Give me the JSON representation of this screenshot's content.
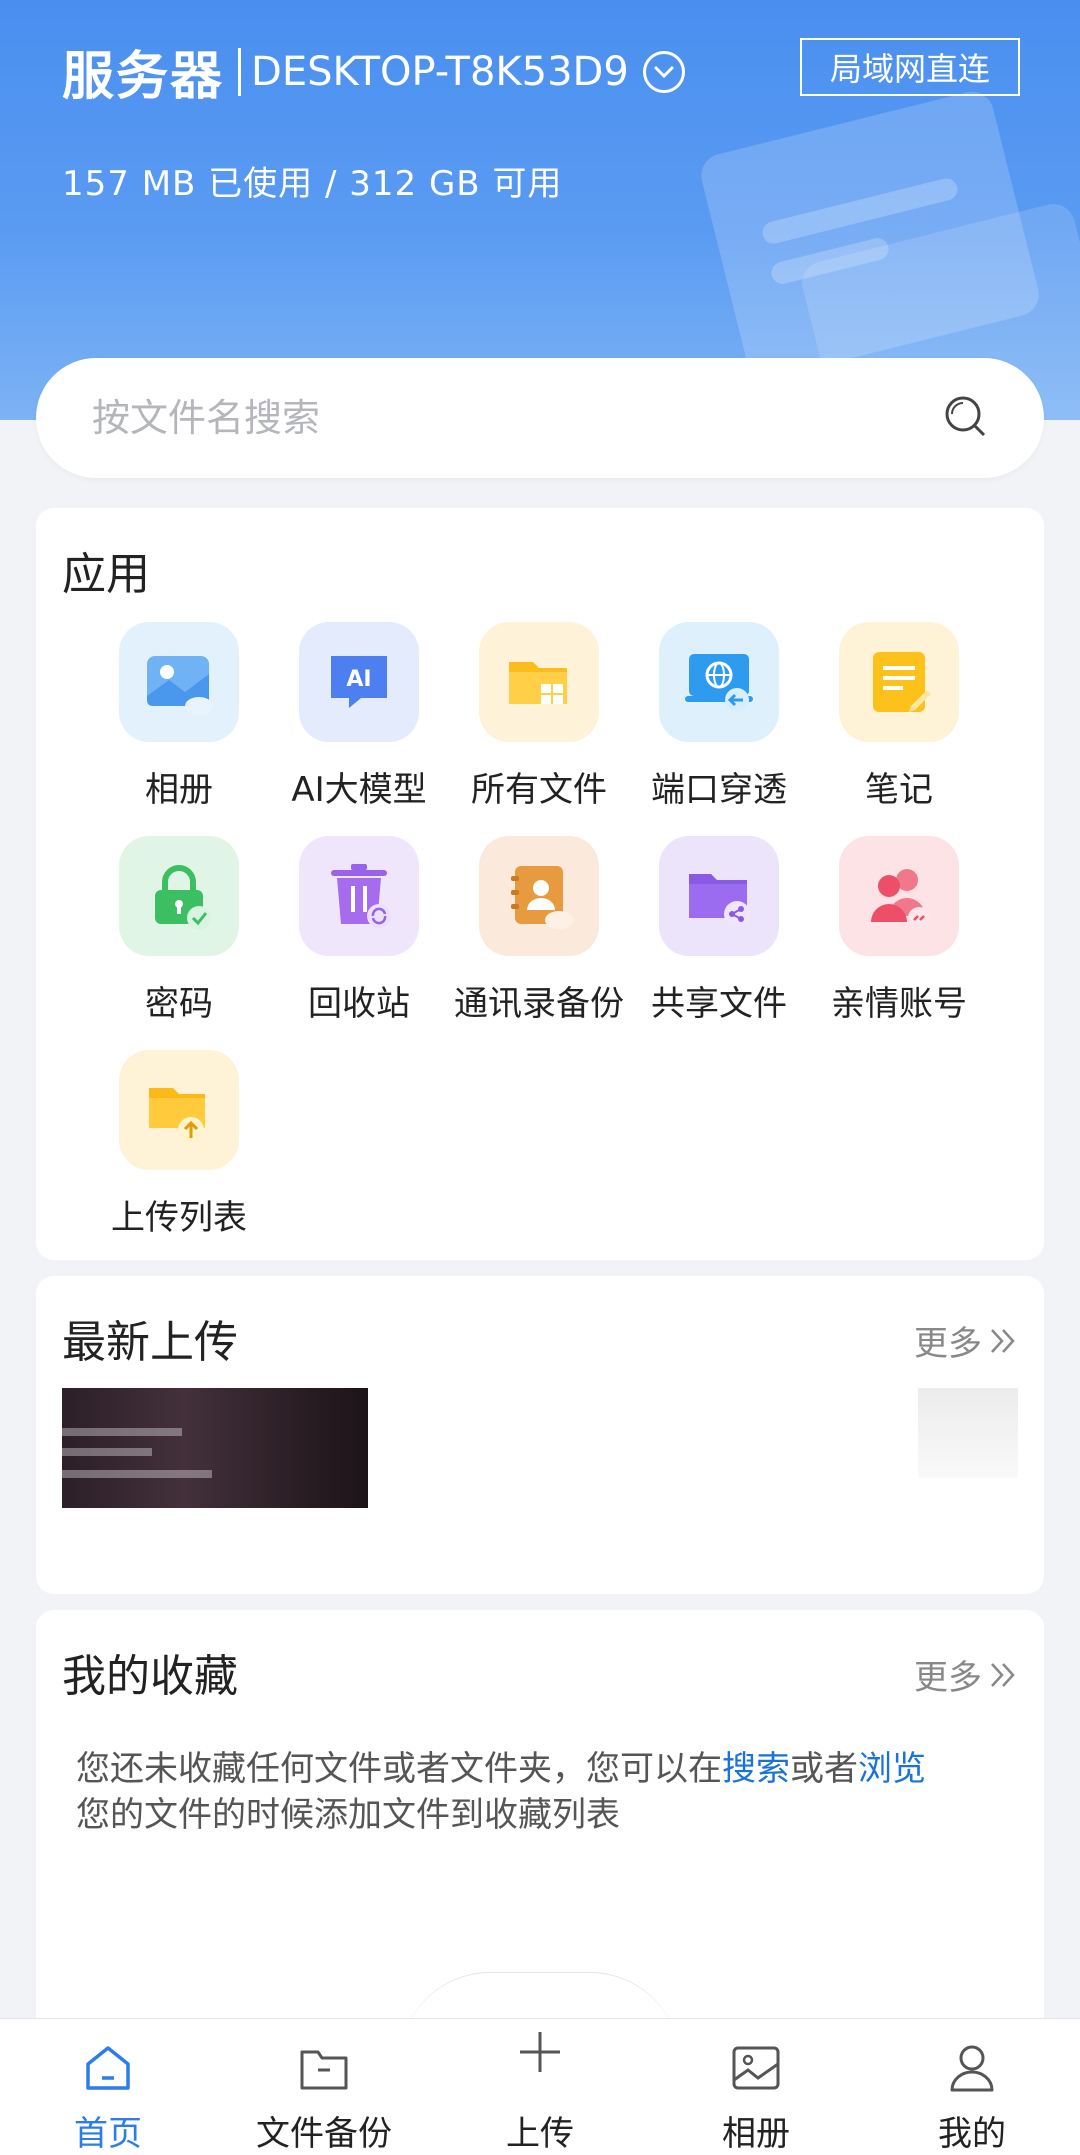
{
  "header": {
    "server_label": "服务器",
    "server_name": "DESKTOP-T8K53D9",
    "lan_badge": "局域网直连",
    "usage": "157 MB 已使用 / 312 GB 可用"
  },
  "search": {
    "placeholder": "按文件名搜索",
    "icon": "search-icon"
  },
  "apps": {
    "title": "应用",
    "items": [
      {
        "label": "相册",
        "icon": "album-icon"
      },
      {
        "label": "AI大模型",
        "icon": "ai-model-icon"
      },
      {
        "label": "所有文件",
        "icon": "all-files-icon"
      },
      {
        "label": "端口穿透",
        "icon": "port-forward-icon"
      },
      {
        "label": "笔记",
        "icon": "notes-icon"
      },
      {
        "label": "密码",
        "icon": "password-icon"
      },
      {
        "label": "回收站",
        "icon": "recycle-bin-icon"
      },
      {
        "label": "通讯录备份",
        "icon": "contacts-backup-icon"
      },
      {
        "label": "共享文件",
        "icon": "shared-files-icon"
      },
      {
        "label": "亲情账号",
        "icon": "family-account-icon"
      },
      {
        "label": "上传列表",
        "icon": "upload-list-icon"
      }
    ]
  },
  "recent": {
    "title": "最新上传",
    "more": "更多"
  },
  "favorites": {
    "title": "我的收藏",
    "more": "更多",
    "empty_prefix": "您还未收藏任何文件或者文件夹，您可以在",
    "link_search": "搜索",
    "empty_mid": "或者",
    "link_browse": "浏览",
    "empty_suffix": "您的文件的时候添加文件到收藏列表"
  },
  "nav": {
    "items": [
      {
        "label": "首页",
        "icon": "home-icon",
        "active": true
      },
      {
        "label": "文件备份",
        "icon": "folder-icon",
        "active": false
      },
      {
        "label": "上传",
        "icon": "plus-icon",
        "active": false
      },
      {
        "label": "相册",
        "icon": "image-icon",
        "active": false
      },
      {
        "label": "我的",
        "icon": "user-icon",
        "active": false
      }
    ]
  },
  "colors": {
    "accent": "#2b7de9",
    "header_gradient_top": "#4a8ff0",
    "link": "#1a73d9"
  }
}
